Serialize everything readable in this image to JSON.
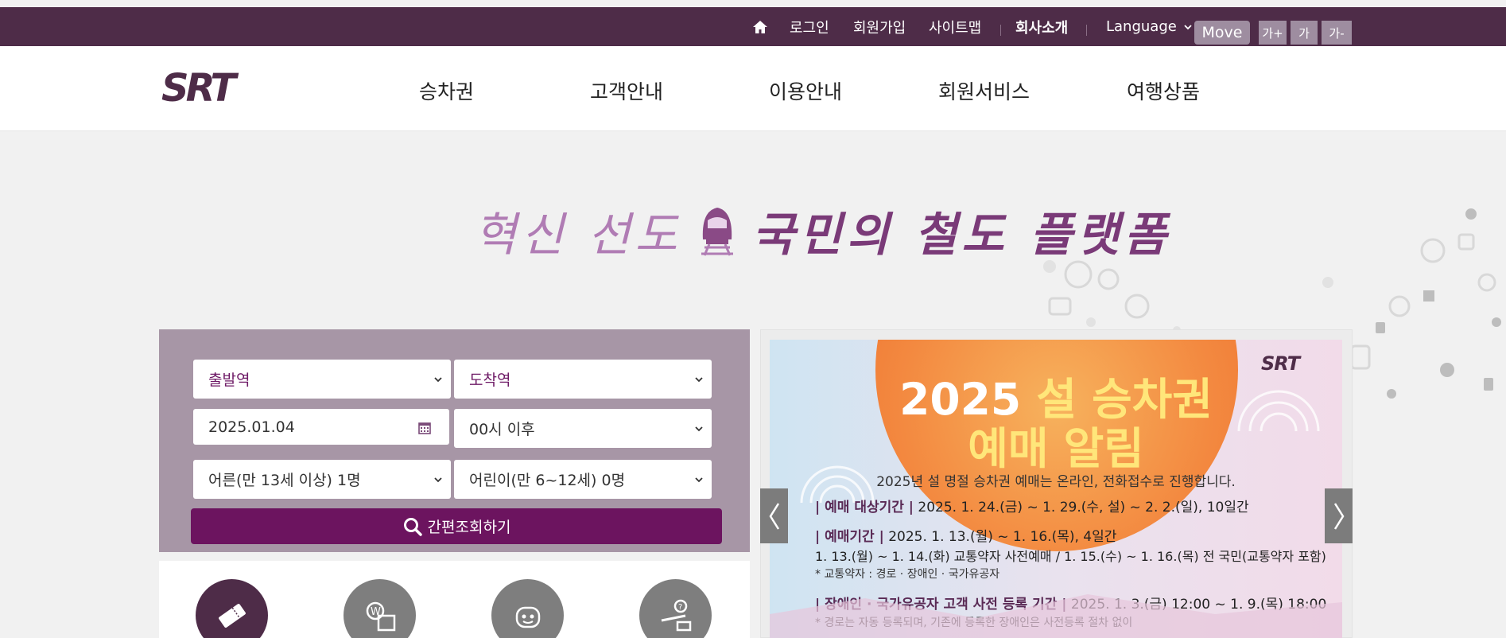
{
  "utility": {
    "login": "로그인",
    "signup": "회원가입",
    "sitemap": "사이트맵",
    "company": "회사소개",
    "language": "Language",
    "move": "Move",
    "font_plus": "가+",
    "font_normal": "가",
    "font_minus": "가-"
  },
  "nav": {
    "logo": "SRT",
    "items": [
      "승차권",
      "고객안내",
      "이용안내",
      "회원서비스",
      "여행상품"
    ]
  },
  "hero": {
    "part1": "혁신 선도",
    "part2": "국민의 철도 플랫폼"
  },
  "search": {
    "departure": "출발역",
    "arrival": "도착역",
    "date": "2025.01.04",
    "time": "00시 이후",
    "adult": "어른(만 13세 이상) 1명",
    "child": "어린이(만 6~12세) 0명",
    "button": "간편조회하기"
  },
  "banner": {
    "logo": "SRT",
    "title_year": "2025",
    "title_rest": "설 승차권",
    "title_line2": "예매 알림",
    "subtitle": "2025년 설 명절 승차권 예매는 온라인, 전화접수로 진행합니다.",
    "line1_label": "| 예매 대상기간 |",
    "line1_text": "2025. 1. 24.(금) ~ 1. 29.(수, 설) ~ 2. 2.(일), 10일간",
    "line2_label": "| 예매기간 |",
    "line2_text": "2025. 1. 13.(월) ~ 1. 16.(목), 4일간",
    "line3_text": "1. 13.(월) ~ 1. 14.(화) 교통약자 사전예매 / 1. 15.(수) ~ 1. 16.(목) 전 국민(교통약자 포함)",
    "line3_note": "* 교통약자 : 경로 · 장애인 · 국가유공자",
    "line4_label": "| 장애인 · 국가유공자 고객 사전 등록 기간 |",
    "line4_text": "2025. 1. 3.(금) 12:00 ~ 1. 9.(목) 18:00",
    "line4_note": "* 경로는 자동 등록되며, 기존에 등록한 장애인은 사전등록 절차 없이"
  },
  "colors": {
    "brand_purple": "#4e2c48",
    "search_button": "#6c145f",
    "panel": "#a796a6"
  }
}
